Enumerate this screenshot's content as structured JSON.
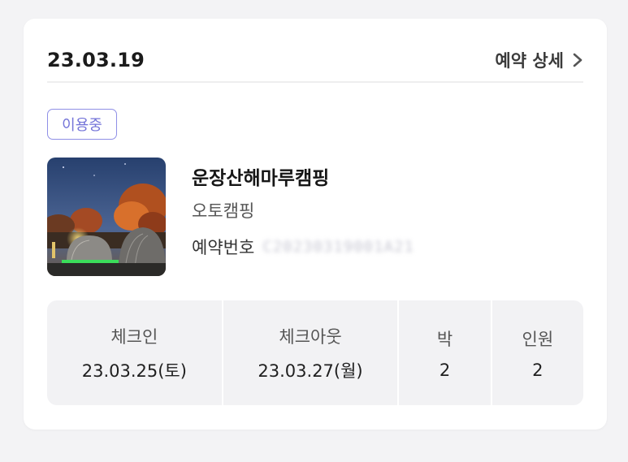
{
  "header": {
    "date": "23.03.19",
    "detail_label": "예약 상세"
  },
  "status_badge": "이용중",
  "campsite": {
    "name": "운장산해마루캠핑",
    "type": "오토캠핑",
    "reservation_label": "예약번호",
    "reservation_number": "C20230319001A21"
  },
  "stats": {
    "checkin": {
      "label": "체크인",
      "value": "23.03.25(토)"
    },
    "checkout": {
      "label": "체크아웃",
      "value": "23.03.27(월)"
    },
    "nights": {
      "label": "박",
      "value": "2"
    },
    "people": {
      "label": "인원",
      "value": "2"
    }
  },
  "colors": {
    "badge": "#7373d8",
    "background": "#f3f3f5",
    "stats_bg": "#f2f2f4"
  }
}
